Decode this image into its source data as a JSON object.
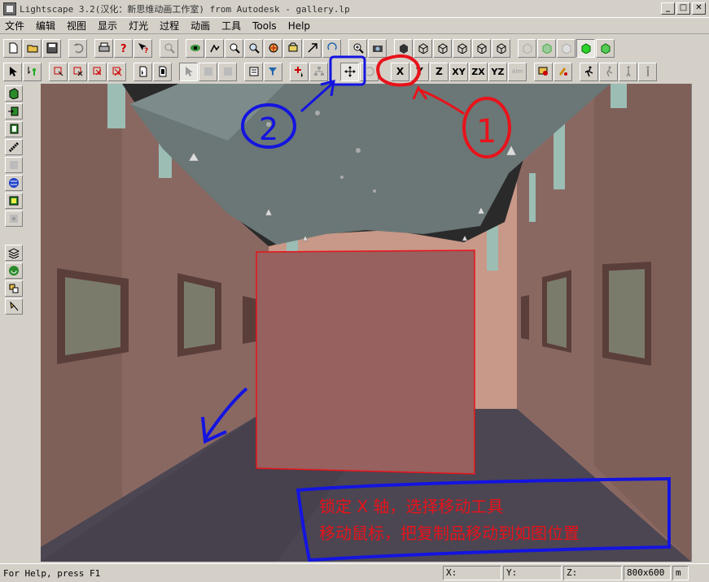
{
  "window": {
    "title": "Lightscape 3.2(汉化：新思维动画工作室) from Autodesk - gallery.lp",
    "buttons": [
      "_",
      "□",
      "✕"
    ]
  },
  "menu": [
    "文件",
    "编辑",
    "视图",
    "显示",
    "灯光",
    "过程",
    "动画",
    "工具",
    "Tools",
    "Help"
  ],
  "toolbar2": {
    "axis_buttons": [
      "X",
      "Y",
      "Z",
      "XY",
      "ZX",
      "YZ",
      "Alm"
    ]
  },
  "annotations": {
    "circle1_label": "1",
    "circle2_label": "2",
    "instruction_line1": "锁定 X 轴，选择移动工具",
    "instruction_line2": "移动鼠标，把复制品移动到如图位置",
    "colors": {
      "red": "#e8131b",
      "blue": "#1414e0"
    }
  },
  "status": {
    "help_text": "For Help, press F1",
    "x_label": "X:",
    "y_label": "Y:",
    "z_label": "Z:",
    "resolution": "800x600",
    "unit": "m"
  }
}
